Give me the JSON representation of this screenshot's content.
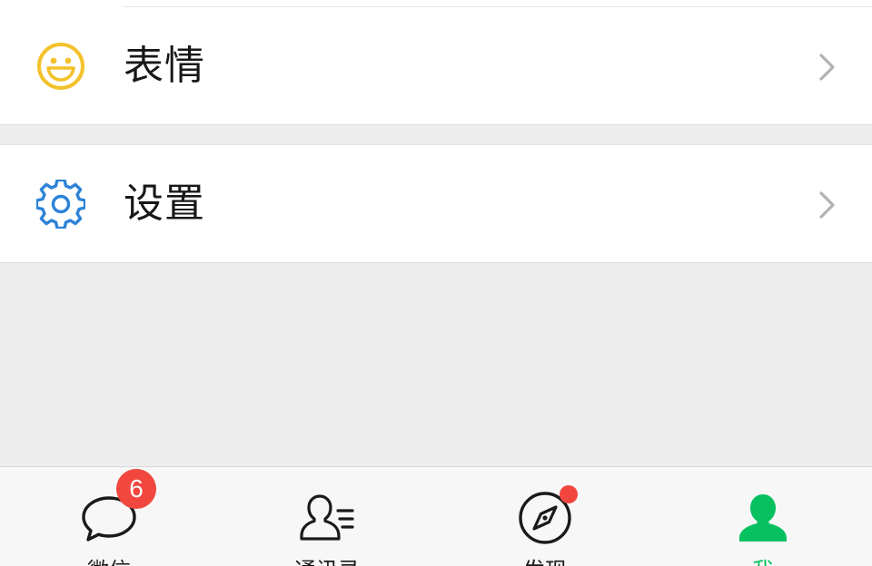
{
  "menu": {
    "items": [
      {
        "label": "表情",
        "icon": "emoji-smile-icon",
        "icon_color": "#f3c12b"
      },
      {
        "label": "设置",
        "icon": "gear-icon",
        "icon_color": "#2c83d8"
      }
    ]
  },
  "tabbar": {
    "tabs": [
      {
        "label": "微信",
        "icon": "chat-bubble-icon",
        "badge": "6"
      },
      {
        "label": "通讯录",
        "icon": "contacts-icon"
      },
      {
        "label": "发现",
        "icon": "compass-icon",
        "has_dot": true
      },
      {
        "label": "我",
        "icon": "me-person-icon",
        "active": true
      }
    ],
    "active_color": "#07c160",
    "badge_color": "#f1473f"
  }
}
